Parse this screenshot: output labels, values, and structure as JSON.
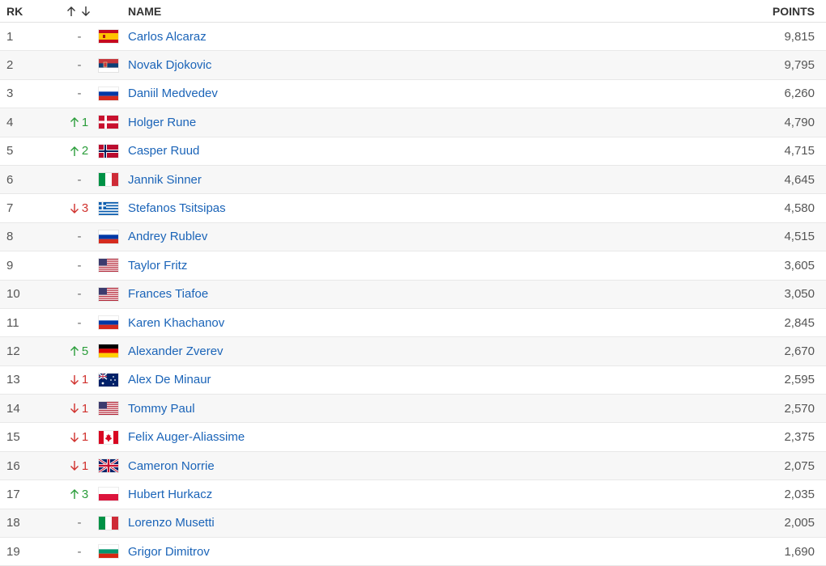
{
  "header": {
    "rank": "RK",
    "name": "NAME",
    "points": "POINTS"
  },
  "colors": {
    "link": "#1b64b8",
    "up": "#2a9d3a",
    "down": "#d0312d"
  },
  "rows": [
    {
      "rank": "1",
      "trend": "-",
      "dir": "none",
      "flag": "esp",
      "name": "Carlos Alcaraz",
      "points": "9,815"
    },
    {
      "rank": "2",
      "trend": "-",
      "dir": "none",
      "flag": "srb",
      "name": "Novak Djokovic",
      "points": "9,795"
    },
    {
      "rank": "3",
      "trend": "-",
      "dir": "none",
      "flag": "rus",
      "name": "Daniil Medvedev",
      "points": "6,260"
    },
    {
      "rank": "4",
      "trend": "1",
      "dir": "up",
      "flag": "den",
      "name": "Holger Rune",
      "points": "4,790"
    },
    {
      "rank": "5",
      "trend": "2",
      "dir": "up",
      "flag": "nor",
      "name": "Casper Ruud",
      "points": "4,715"
    },
    {
      "rank": "6",
      "trend": "-",
      "dir": "none",
      "flag": "ita",
      "name": "Jannik Sinner",
      "points": "4,645"
    },
    {
      "rank": "7",
      "trend": "3",
      "dir": "down",
      "flag": "gre",
      "name": "Stefanos Tsitsipas",
      "points": "4,580"
    },
    {
      "rank": "8",
      "trend": "-",
      "dir": "none",
      "flag": "rus",
      "name": "Andrey Rublev",
      "points": "4,515"
    },
    {
      "rank": "9",
      "trend": "-",
      "dir": "none",
      "flag": "usa",
      "name": "Taylor Fritz",
      "points": "3,605"
    },
    {
      "rank": "10",
      "trend": "-",
      "dir": "none",
      "flag": "usa",
      "name": "Frances Tiafoe",
      "points": "3,050"
    },
    {
      "rank": "11",
      "trend": "-",
      "dir": "none",
      "flag": "rus",
      "name": "Karen Khachanov",
      "points": "2,845"
    },
    {
      "rank": "12",
      "trend": "5",
      "dir": "up",
      "flag": "ger",
      "name": "Alexander Zverev",
      "points": "2,670"
    },
    {
      "rank": "13",
      "trend": "1",
      "dir": "down",
      "flag": "aus",
      "name": "Alex De Minaur",
      "points": "2,595"
    },
    {
      "rank": "14",
      "trend": "1",
      "dir": "down",
      "flag": "usa",
      "name": "Tommy Paul",
      "points": "2,570"
    },
    {
      "rank": "15",
      "trend": "1",
      "dir": "down",
      "flag": "can",
      "name": "Felix Auger-Aliassime",
      "points": "2,375"
    },
    {
      "rank": "16",
      "trend": "1",
      "dir": "down",
      "flag": "gbr",
      "name": "Cameron Norrie",
      "points": "2,075"
    },
    {
      "rank": "17",
      "trend": "3",
      "dir": "up",
      "flag": "pol",
      "name": "Hubert Hurkacz",
      "points": "2,035"
    },
    {
      "rank": "18",
      "trend": "-",
      "dir": "none",
      "flag": "ita",
      "name": "Lorenzo Musetti",
      "points": "2,005"
    },
    {
      "rank": "19",
      "trend": "-",
      "dir": "none",
      "flag": "bul",
      "name": "Grigor Dimitrov",
      "points": "1,690"
    }
  ]
}
